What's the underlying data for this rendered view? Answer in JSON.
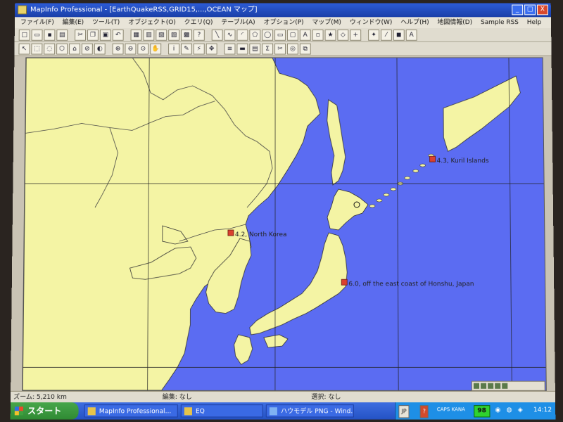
{
  "window": {
    "title": "MapInfo Professional - [EarthQuakeRSS,GRID15,...,OCEAN マップ]",
    "min_glyph": "_",
    "max_glyph": "□",
    "close_glyph": "X"
  },
  "menu": [
    "ファイル(F)",
    "編集(E)",
    "ツール(T)",
    "オブジェクト(O)",
    "クエリ(Q)",
    "テーブル(A)",
    "オプション(P)",
    "マップ(M)",
    "ウィンドウ(W)",
    "ヘルプ(H)",
    "地図情報(D)",
    "Sample RSS",
    "Help"
  ],
  "map": {
    "sea_color": "#5b6cf2",
    "land_color": "#f4f4a4",
    "marker_color": "#d9402f",
    "quakes": [
      {
        "label": "4.3, Kuril Islands"
      },
      {
        "label": "4.2, North Korea"
      },
      {
        "label": "6.0, off the east coast of Honshu, Japan"
      }
    ]
  },
  "status": {
    "zoom": "ズーム: 5,210 km",
    "edit": "編集: なし",
    "select": "選択: なし"
  },
  "taskbar": {
    "start": "スタート",
    "tasks": [
      {
        "label": "MapInfo Professional..."
      },
      {
        "label": "EQ"
      },
      {
        "label": "ハウモデル PNG - Wind..."
      }
    ],
    "tray_ime": "JP",
    "tray_caps": "CAPS KANA",
    "tray_badge": "98",
    "clock": "14:12"
  }
}
